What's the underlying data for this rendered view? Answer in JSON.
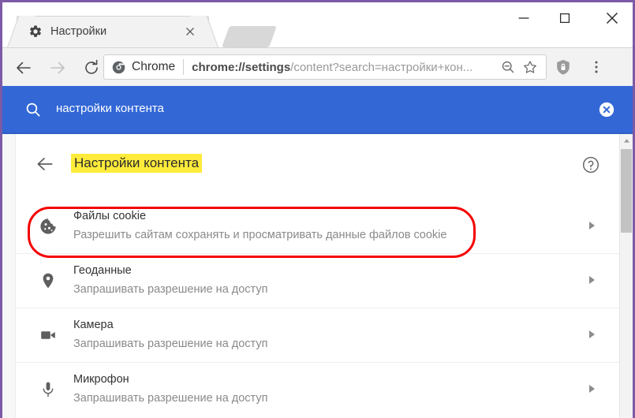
{
  "window": {
    "border_color": "#7c5aa6",
    "controls": {
      "minimize": "minimize-button",
      "maximize": "maximize-button",
      "close": "close-button"
    }
  },
  "tabs": {
    "active": {
      "title": "Настройки",
      "icon": "gear-icon",
      "close_label": "×"
    },
    "new_tab_placeholder": ""
  },
  "toolbar": {
    "back_icon": "back-arrow-icon",
    "forward_icon": "forward-arrow-icon",
    "reload_icon": "reload-icon",
    "omnibox": {
      "chrome_label": "Chrome",
      "url_bold": "chrome://settings",
      "url_rest": "/content?search=настройки+кон...",
      "url_full": "chrome://settings/content?search=настройки+кон...",
      "zoom_icon": "zoom-out-icon",
      "star_icon": "bookmark-star-icon"
    },
    "shield_icon": "shield-lock-icon",
    "menu_icon": "three-dots-menu-icon"
  },
  "search_banner": {
    "background": "#3367d6",
    "icon": "search-icon",
    "query": "настройки контента",
    "close_icon": "clear-search-icon"
  },
  "page": {
    "back_icon": "back-arrow-icon",
    "title": "Настройки контента",
    "title_highlight_color": "#ffeb3b",
    "help_icon": "help-circle-icon",
    "rows": [
      {
        "icon": "cookie-icon",
        "title": "Файлы cookie",
        "subtitle": "Разрешить сайтам сохранять и просматривать данные файлов cookie",
        "chevron": "chevron-right-icon"
      },
      {
        "icon": "location-pin-icon",
        "title": "Геоданные",
        "subtitle": "Запрашивать разрешение на доступ",
        "chevron": "chevron-right-icon"
      },
      {
        "icon": "camera-icon",
        "title": "Камера",
        "subtitle": "Запрашивать разрешение на доступ",
        "chevron": "chevron-right-icon"
      },
      {
        "icon": "microphone-icon",
        "title": "Микрофон",
        "subtitle": "Запрашивать разрешение на доступ",
        "chevron": "chevron-right-icon"
      }
    ],
    "annotation": {
      "shape": "rounded-rectangle",
      "color": "#f40000",
      "targets_row": "Файлы cookie"
    }
  },
  "scrollbar": {
    "up_arrow": "scroll-up-arrow-icon",
    "thumb": "scrollbar-thumb"
  }
}
